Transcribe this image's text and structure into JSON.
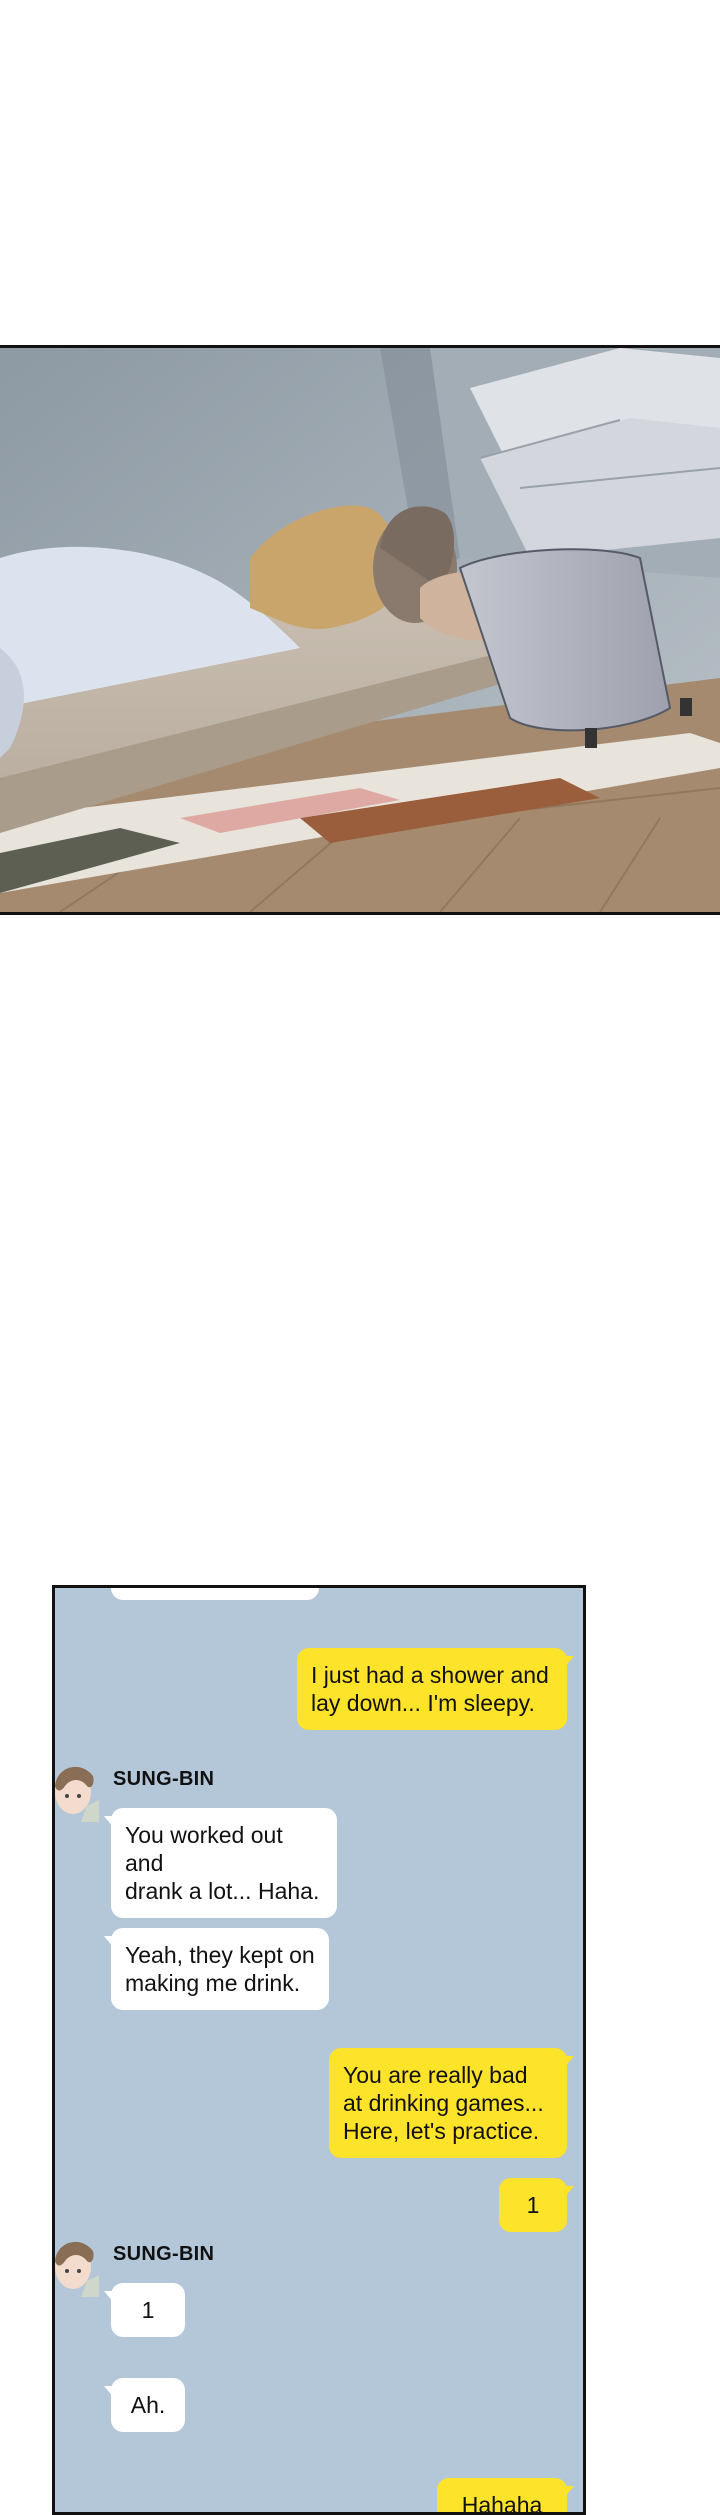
{
  "chat": {
    "messages": [
      {
        "from": "other",
        "text": ""
      },
      {
        "from": "me",
        "text": "I just had a shower and\nlay down... I'm sleepy."
      },
      {
        "from": "other",
        "sender": "SUNG-BIN",
        "text": "You worked out and\ndrank a lot... Haha."
      },
      {
        "from": "other",
        "text": "Yeah, they kept on\nmaking me drink."
      },
      {
        "from": "me",
        "text": "You are really bad\nat drinking games...\nHere, let's practice."
      },
      {
        "from": "me",
        "text": "1"
      },
      {
        "from": "other",
        "sender": "SUNG-BIN",
        "text": "1"
      },
      {
        "from": "other",
        "text": "Ah."
      },
      {
        "from": "me",
        "text": "Hahaha"
      }
    ]
  },
  "colors": {
    "chat_background": "#b3c7d9",
    "my_bubble": "#fde32a",
    "their_bubble": "#ffffff",
    "panel_border": "#111111"
  }
}
